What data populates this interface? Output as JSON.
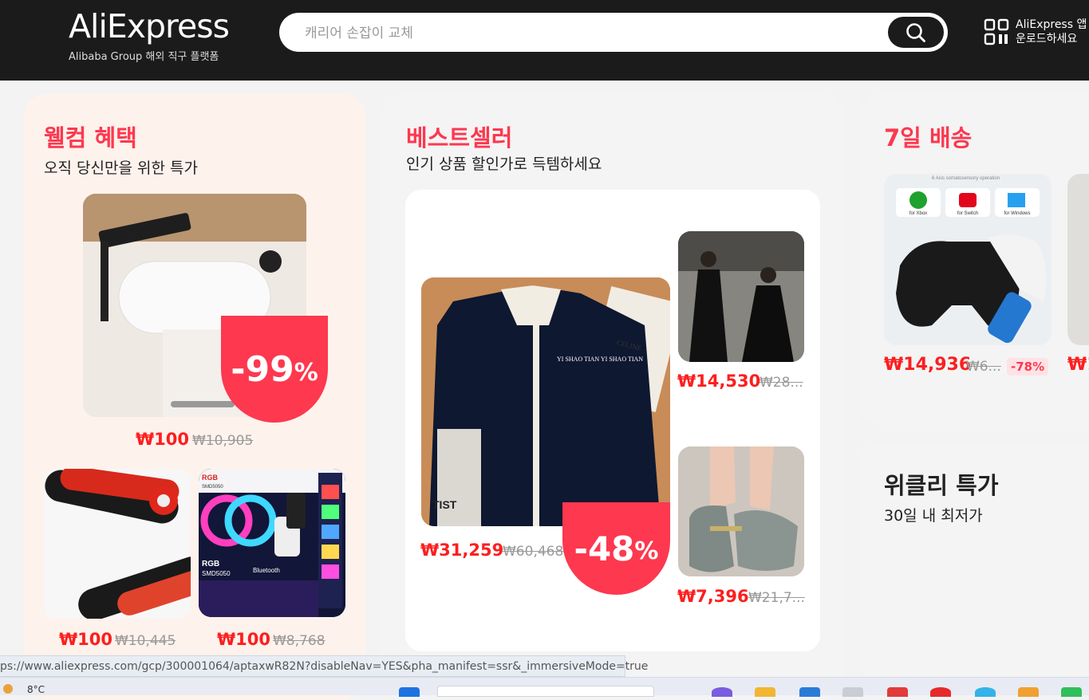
{
  "header": {
    "logo": "AliExpress",
    "tagline": "Alibaba Group 해외 직구 플랫폼",
    "search_placeholder": "캐리어 손잡이 교체",
    "app_line1": "AliExpress 앱",
    "app_line2": "운로드하세요"
  },
  "welcome": {
    "title": "웰컴 혜택",
    "subtitle": "오직 당신만을 위한 특가",
    "main": {
      "discount_num": "-99",
      "discount_pct": "%",
      "price": "₩100",
      "orig": "₩10,905"
    },
    "items": [
      {
        "price": "₩100",
        "orig": "₩10,445"
      },
      {
        "price": "₩100",
        "orig": "₩8,768"
      }
    ]
  },
  "bestsellers": {
    "title": "베스트셀러",
    "subtitle": "인기 상품 할인가로 득템하세요",
    "main": {
      "discount_num": "-48",
      "discount_pct": "%",
      "price": "₩31,259",
      "orig": "₩60,468",
      "jacket_text": "YI SHAO TIAN YI SHAO TIAN",
      "book_text": "CELINE",
      "tag_text": "TIST"
    },
    "items": [
      {
        "price": "₩14,530",
        "orig": "₩28..."
      },
      {
        "price": "₩7,396",
        "orig": "₩21,7..."
      }
    ]
  },
  "seven_day": {
    "title": "7일 배송",
    "image_caption": "6 Axis somatosensory operation",
    "platforms": [
      "for Xbox",
      "for Switch",
      "for Windows"
    ],
    "item": {
      "price": "₩14,936",
      "orig": "₩6...",
      "badge": "-78%"
    },
    "next_price": "₩1"
  },
  "weekly": {
    "title": "위클리 특가",
    "subtitle": "30일 내 최저가"
  },
  "led_product": {
    "label_top": "RGB",
    "label_model_top": "SMD5050",
    "label_bottom": "RGB",
    "label_model": "SMD5050",
    "label_bt": "Bluetooth"
  },
  "statusbar": {
    "url": "ps://www.aliexpress.com/gcp/300001064/aptaxwR82N?disableNav=YES&pha_manifest=ssr&_immersiveMode=true"
  },
  "taskbar": {
    "weather": "8°C"
  },
  "colors": {
    "accent": "#fd384f",
    "price": "#fd1e1e",
    "header": "#1b1b1b"
  }
}
